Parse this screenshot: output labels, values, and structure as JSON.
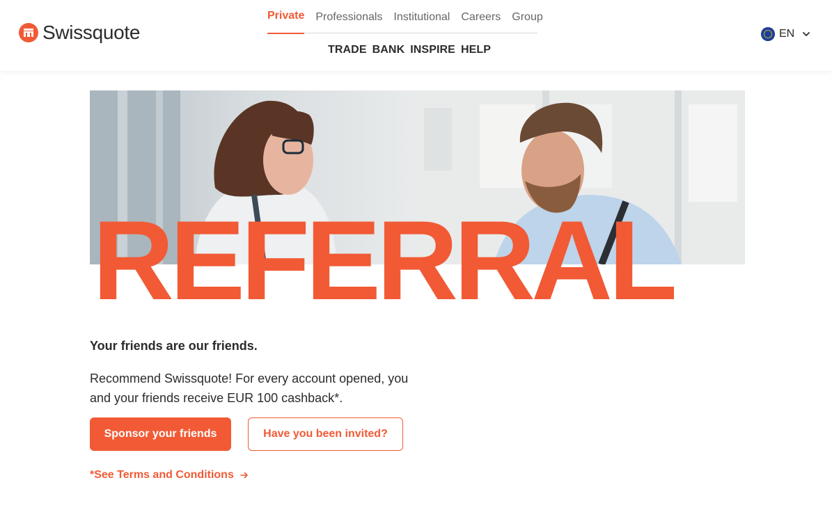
{
  "colors": {
    "accent": "#f15a35",
    "text": "#2b2b2b",
    "nav_muted": "#666666"
  },
  "header": {
    "logo_text": "Swissquote",
    "top_nav": [
      {
        "label": "Private",
        "active": true
      },
      {
        "label": "Professionals",
        "active": false
      },
      {
        "label": "Institutional",
        "active": false
      },
      {
        "label": "Careers",
        "active": false
      },
      {
        "label": "Group",
        "active": false
      }
    ],
    "sub_nav": [
      "TRADE",
      "BANK",
      "INSPIRE",
      "HELP"
    ],
    "language": {
      "label": "EN",
      "icon": "eu-flag-icon"
    }
  },
  "hero": {
    "headline": "REFERRAL"
  },
  "content": {
    "tagline": "Your friends are our friends.",
    "description": "Recommend Swissquote! For every account opened, you and your friends receive EUR 100 cashback*.",
    "primary_button": "Sponsor your friends",
    "secondary_button": "Have you been invited?",
    "terms_link": "*See Terms and Conditions",
    "terms_icon": "arrow-right-icon"
  }
}
